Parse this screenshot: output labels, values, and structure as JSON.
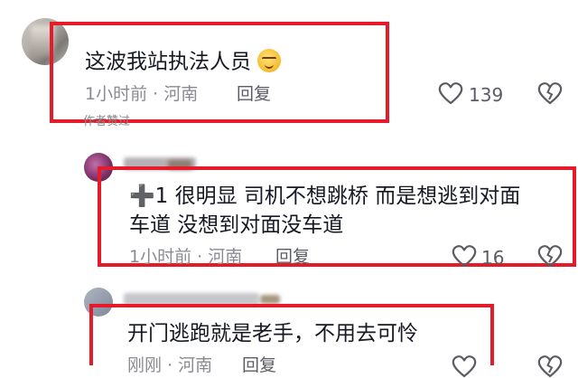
{
  "comments": [
    {
      "text": "这波我站执法人员",
      "emoji": "smirk-face-icon",
      "time": "1小时前",
      "location": "河南",
      "reply_label": "回复",
      "likes": "139",
      "author_liked": "作者赞过"
    },
    {
      "text_line1": "➕1 很明显 司机不想跳桥 而是想逃到对面",
      "text_line2": "车道 没想到对面没车道",
      "time": "1小时前",
      "location": "河南",
      "reply_label": "回复",
      "likes": "16"
    },
    {
      "text": "开门逃跑就是老手，不用去可怜",
      "time": "刚刚",
      "location": "河南",
      "reply_label": "回复"
    }
  ],
  "meta_separator": "·",
  "highlight_color": "#e51b2a"
}
